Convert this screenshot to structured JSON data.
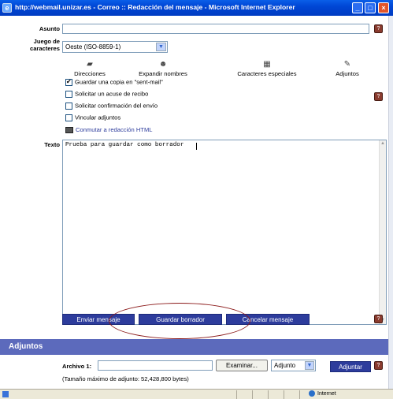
{
  "window": {
    "title": "http://webmail.unizar.es - Correo :: Redacción del mensaje - Microsoft Internet Explorer",
    "minimize": "_",
    "maximize": "□",
    "close": "×"
  },
  "form": {
    "subject_label": "Asunto",
    "subject_value": "",
    "charset_label_1": "Juego de",
    "charset_label_2": "caracteres",
    "charset_value": "Oeste (ISO-8859-1)",
    "toolbar": [
      {
        "label": "Direcciones",
        "icon": "address-book-icon"
      },
      {
        "label": "Expandir nombres",
        "icon": "people-icon"
      },
      {
        "label": "Caracteres especiales",
        "icon": "special-chars-icon"
      },
      {
        "label": "Adjuntos",
        "icon": "paperclip-icon"
      }
    ],
    "options": [
      {
        "label": "Guardar una copia en \"sent-mail\"",
        "checked": true
      },
      {
        "label": "Solicitar un acuse de recibo",
        "checked": false
      },
      {
        "label": "Solicitar confirmación del envío",
        "checked": false
      },
      {
        "label": "Vincular adjuntos",
        "checked": false
      }
    ],
    "html_link": "Conmutar a redacción HTML",
    "text_label": "Texto",
    "text_value": "Prueba para guardar como borrador"
  },
  "actions": {
    "send": "Enviar mensaje",
    "save_draft": "Guardar borrador",
    "cancel": "Cancelar mensaje"
  },
  "attachments": {
    "header": "Adjuntos",
    "file_label": "Archivo 1:",
    "file_value": "",
    "browse": "Examinar...",
    "type_value": "Adjunto",
    "attach_button": "Adjuntar",
    "max_size_note": "(Tamaño máximo de adjunto: 52,428,800 bytes)"
  },
  "status": {
    "zone": "Internet"
  },
  "colors": {
    "action_button": "#2d3c9c",
    "header_bar": "#5c6abc",
    "annotation_oval": "#8b1a1a"
  }
}
